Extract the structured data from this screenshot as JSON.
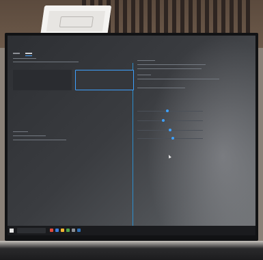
{
  "photo": {
    "subject": ""
  }
}
